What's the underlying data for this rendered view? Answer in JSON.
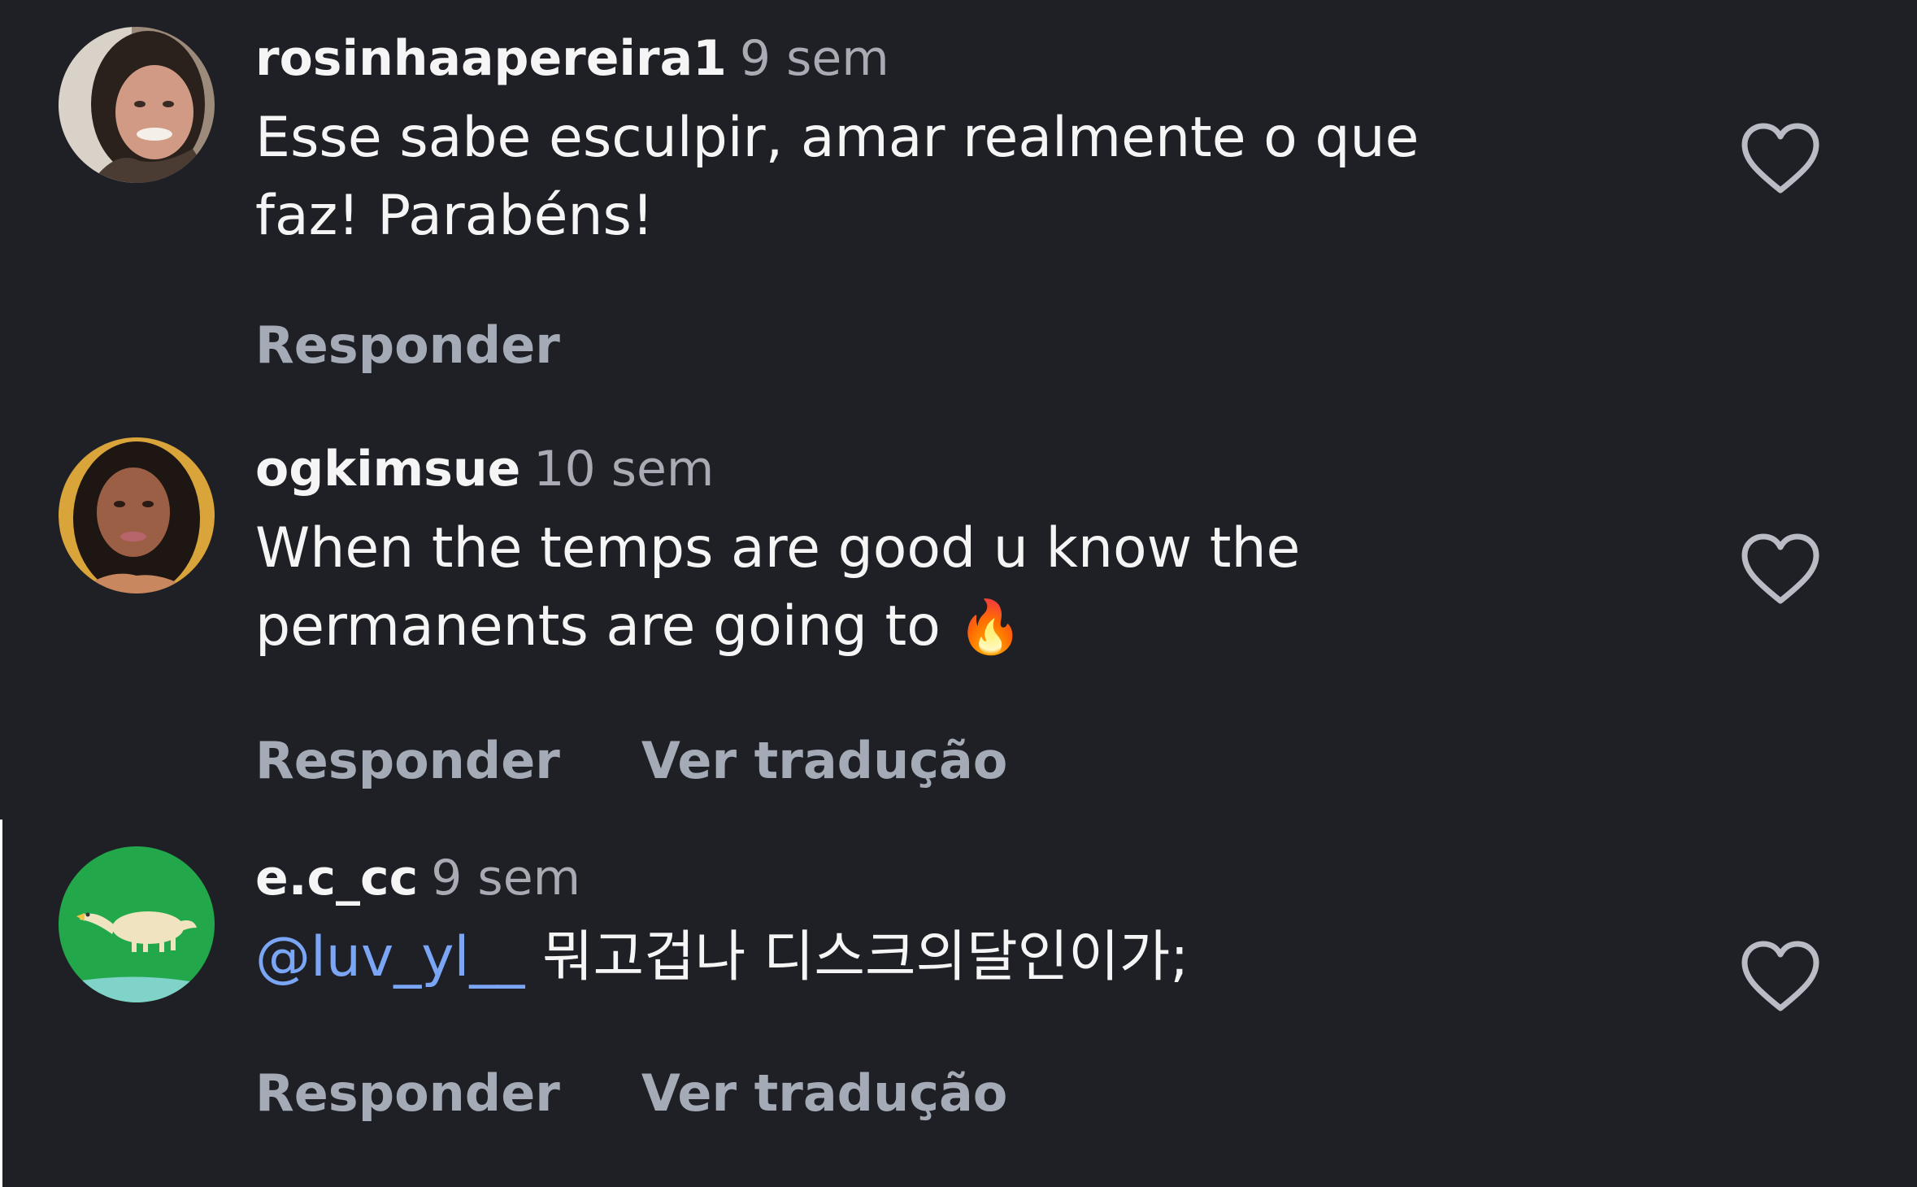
{
  "comments": [
    {
      "username": "rosinhaapereira1",
      "time": "9 sem",
      "text_lines": [
        "Esse sabe esculpir, amar realmente o que",
        "faz! Parabéns!"
      ],
      "reply_label": "Responder"
    },
    {
      "username": "ogkimsue",
      "time": "10 sem",
      "text_lines": [
        "When the temps are good u know the",
        "permanents are going to"
      ],
      "emoji": "🔥",
      "reply_label": "Responder",
      "translate_label": "Ver tradução"
    },
    {
      "username": "e.c_cc",
      "time": "9 sem",
      "mention": "@luv_yl__",
      "text_after_mention": " 뭐고겁나 디스크의달인이가;",
      "reply_label": "Responder",
      "translate_label": "Ver tradução"
    }
  ],
  "icons": {
    "like": "heart-outline-icon"
  },
  "colors": {
    "background": "#1f2025",
    "username": "#f5f5f5",
    "meta": "#a8abb3",
    "mention": "#7aa6f5",
    "action": "#a4abb7"
  }
}
